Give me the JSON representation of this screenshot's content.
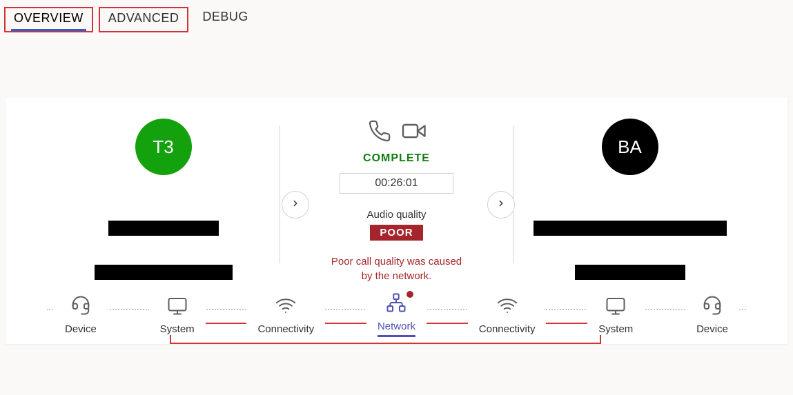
{
  "tabs": {
    "overview": "OVERVIEW",
    "advanced": "ADVANCED",
    "debug": "DEBUG"
  },
  "caller": {
    "initials": "T3"
  },
  "callee": {
    "initials": "BA"
  },
  "center": {
    "status": "COMPLETE",
    "duration": "00:26:01",
    "quality_label": "Audio quality",
    "quality_badge": "POOR",
    "quality_message_line1": "Poor call quality was caused",
    "quality_message_line2": "by the network."
  },
  "bottom": {
    "device": "Device",
    "system": "System",
    "connectivity": "Connectivity",
    "network": "Network"
  }
}
